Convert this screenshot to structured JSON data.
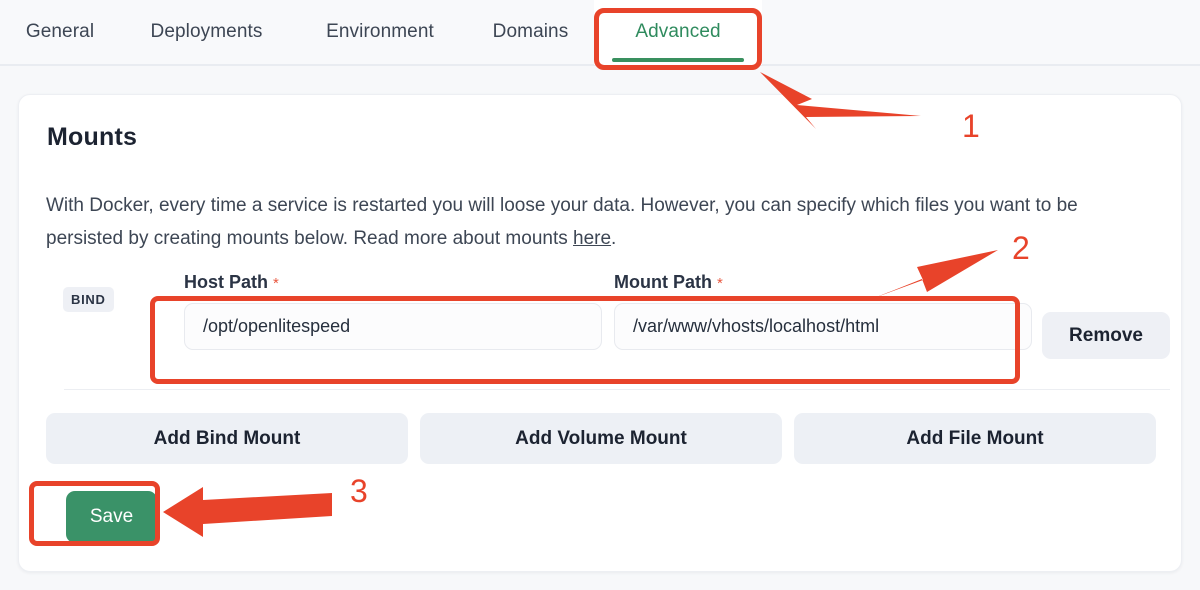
{
  "tabs": [
    {
      "label": "General",
      "active": false
    },
    {
      "label": "Deployments",
      "active": false
    },
    {
      "label": "Environment",
      "active": false
    },
    {
      "label": "Domains",
      "active": false
    },
    {
      "label": "Advanced",
      "active": true
    }
  ],
  "card": {
    "title": "Mounts",
    "description_part1": "With Docker, every time a service is restarted you will loose your data. However, you can specify which files you want to be persisted by creating mounts below. Read more about mounts ",
    "description_link": "here",
    "description_part2": "."
  },
  "mount_row": {
    "type_badge": "BIND",
    "host_path": {
      "label": "Host Path",
      "required_marker": "*",
      "value": "/opt/openlitespeed",
      "placeholder": "Host Path"
    },
    "mount_path": {
      "label": "Mount Path",
      "required_marker": "*",
      "value": "/var/www/vhosts/localhost/html",
      "placeholder": "Mount Path"
    },
    "remove_label": "Remove"
  },
  "add_buttons": [
    {
      "label": "Add Bind Mount"
    },
    {
      "label": "Add Volume Mount"
    },
    {
      "label": "Add File Mount"
    }
  ],
  "save": {
    "label": "Save"
  },
  "annotations": {
    "step1": "1",
    "step2": "2",
    "step3": "3",
    "color": "#e8432a"
  },
  "colors": {
    "accent_green": "#3a9268",
    "active_tab_text": "#2f8b5e",
    "annotation_red": "#e8432a",
    "page_background": "#f7f8fa",
    "card_background": "#ffffff",
    "muted_button": "#edf0f5",
    "required_marker": "#e8573f"
  }
}
